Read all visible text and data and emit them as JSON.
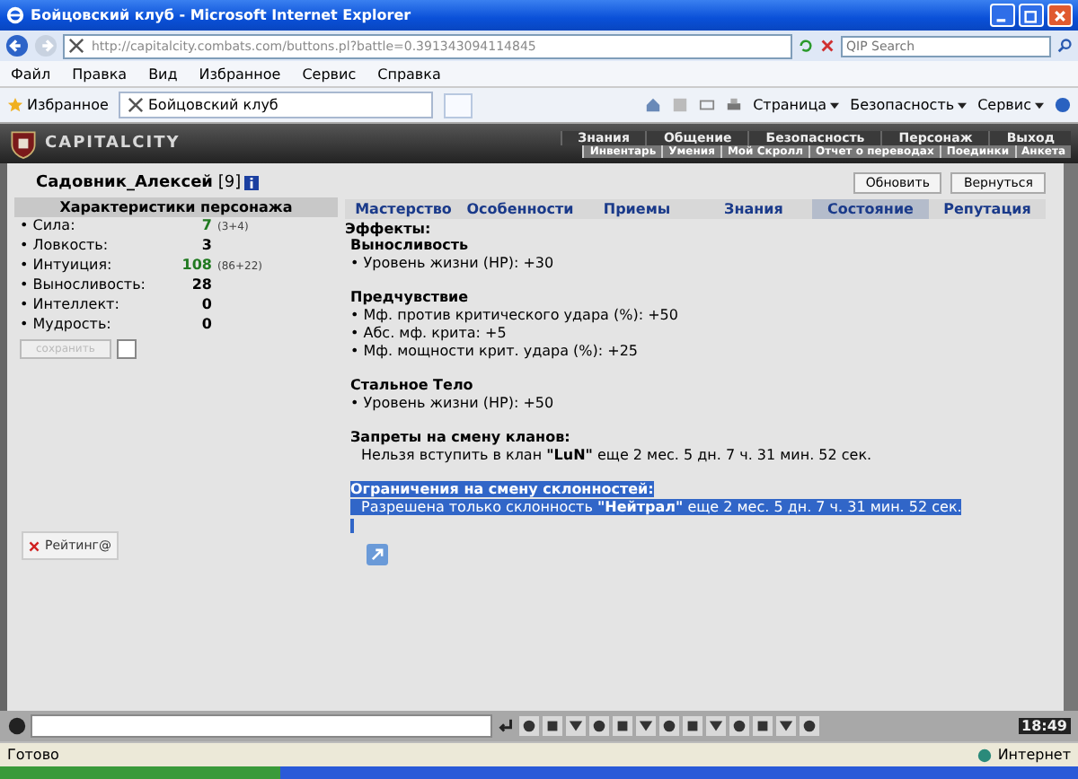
{
  "window": {
    "title": "Бойцовский клуб - Microsoft Internet Explorer"
  },
  "address_bar": {
    "url": "http://capitalcity.combats.com/buttons.pl?battle=0.391343094114845"
  },
  "search": {
    "placeholder": "QIP Search"
  },
  "menu": [
    "Файл",
    "Правка",
    "Вид",
    "Избранное",
    "Сервис",
    "Справка"
  ],
  "favorites": {
    "label": "Избранное"
  },
  "tab": {
    "title": "Бойцовский клуб"
  },
  "command_bar": [
    "Страница",
    "Безопасность",
    "Сервис"
  ],
  "game": {
    "logo": "CAPITALCITY",
    "nav_top": [
      "Знания",
      "Общение",
      "Безопасность",
      "Персонаж",
      "Выход"
    ],
    "nav_sub": [
      "Инвентарь",
      "Умения",
      "Мой Скролл",
      "Отчет о переводах",
      "Поединки",
      "Анкета"
    ]
  },
  "character": {
    "name": "Садовник_Алексей",
    "level": "[9]"
  },
  "buttons": [
    "Обновить",
    "Вернуться"
  ],
  "stats": {
    "title": "Характеристики персонажа",
    "rows": [
      {
        "name": "• Сила:",
        "value": "7",
        "bonus": "(3+4)",
        "boosted": true
      },
      {
        "name": "• Ловкость:",
        "value": "3",
        "boosted": false
      },
      {
        "name": "• Интуиция:",
        "value": "108",
        "bonus": "(86+22)",
        "boosted": true
      },
      {
        "name": "• Выносливость:",
        "value": "28",
        "boosted": false
      },
      {
        "name": "• Интеллект:",
        "value": "0",
        "boosted": false
      },
      {
        "name": "• Мудрость:",
        "value": "0",
        "boosted": false
      }
    ]
  },
  "save_button": {
    "label": "сохранить",
    "disabled": true
  },
  "save_checkbox": {
    "checked": false
  },
  "tabs": [
    {
      "label": "Мастерство",
      "selected": false
    },
    {
      "label": "Особенности",
      "selected": false
    },
    {
      "label": "Приемы",
      "selected": false
    },
    {
      "label": "Знания",
      "selected": false
    },
    {
      "label": "Состояние",
      "selected": true
    },
    {
      "label": "Репутация",
      "selected": false
    }
  ],
  "effects": {
    "title": "Эффекты:",
    "groups": [
      {
        "title": "Выносливость",
        "lines": [
          "• Уровень жизни (HP): +30"
        ]
      },
      {
        "title": "Предчувствие",
        "lines": [
          "• Мф. против критического удара (%): +50",
          "• Абс. мф. крита: +5",
          "• Мф. мощности крит. удара (%): +25"
        ]
      },
      {
        "title": "Стальное Тело",
        "lines": [
          "• Уровень жизни (HP): +50"
        ]
      }
    ]
  },
  "notices": [
    {
      "title": "Запреты на смену кланов:",
      "text": "Нельзя вступить в клан **\"LuN\"** еще 2 мес. 5 дн. 7 ч. 31 мин. 52 сек.",
      "selected": false
    },
    {
      "title": "Ограничения на смену склонностей:",
      "text": "Разрешена только склонность **\"Нейтрал\"** еще 2 мес. 5 дн. 7 ч. 31 мин. 52 сек.",
      "selected": true
    }
  ],
  "rating": {
    "label": "Рейтинг@"
  },
  "clock": "18:49",
  "status_bar": {
    "text": "Готово",
    "zone": "Интернет"
  }
}
